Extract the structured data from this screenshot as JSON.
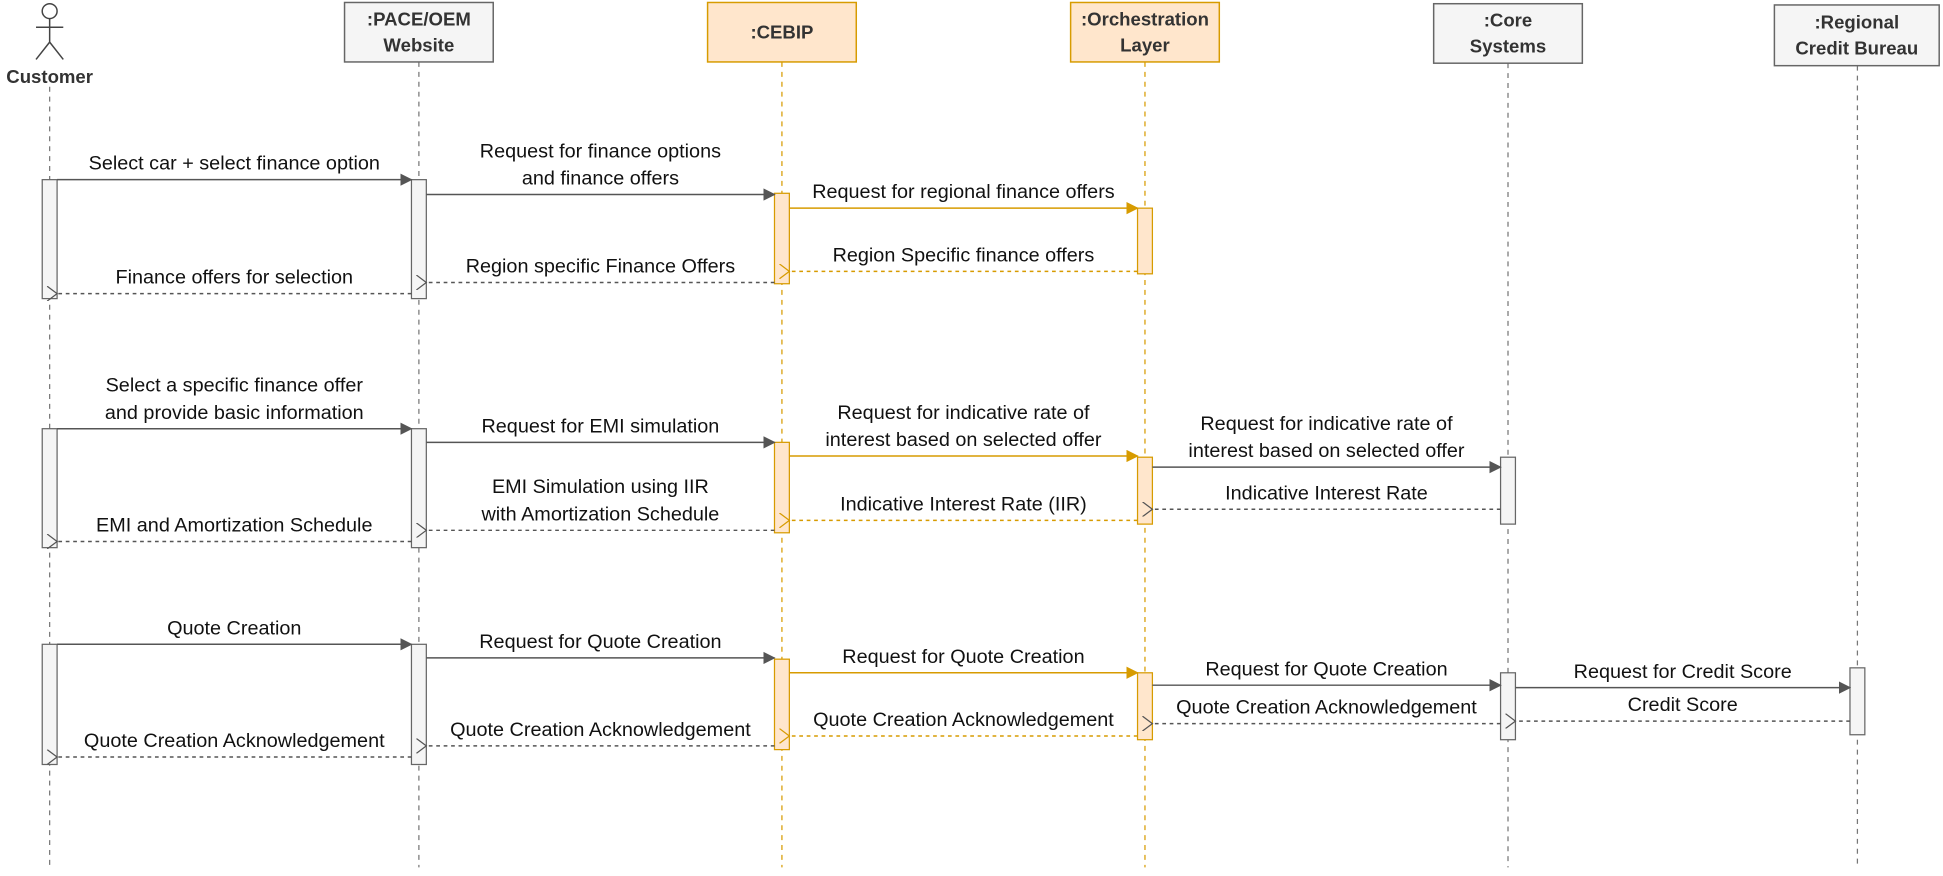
{
  "colors": {
    "accent_fill": "#ffe6cc",
    "accent_stroke": "#d79b00",
    "neutral_fill": "#f5f5f5",
    "neutral_stroke": "#666666",
    "arrow": "#555555"
  },
  "participants": [
    {
      "id": "customer",
      "kind": "actor",
      "lines": [
        "Customer"
      ],
      "highlight": false
    },
    {
      "id": "website",
      "kind": "box",
      "lines": [
        ":PACE/OEM",
        "Website"
      ],
      "highlight": false
    },
    {
      "id": "cebip",
      "kind": "box",
      "lines": [
        ":CEBIP"
      ],
      "highlight": true
    },
    {
      "id": "orchestration",
      "kind": "box",
      "lines": [
        ":Orchestration",
        "Layer"
      ],
      "highlight": true
    },
    {
      "id": "core",
      "kind": "box",
      "lines": [
        ":Core",
        "Systems"
      ],
      "highlight": false
    },
    {
      "id": "bureau",
      "kind": "box",
      "lines": [
        ":Regional",
        "Credit Bureau"
      ],
      "highlight": false
    }
  ],
  "messages": [
    {
      "from": 0,
      "to": 1,
      "lines": [
        "Select car + select finance option"
      ],
      "dashed": false
    },
    {
      "from": 1,
      "to": 2,
      "lines": [
        "Request for finance options",
        "and finance offers"
      ],
      "dashed": false
    },
    {
      "from": 2,
      "to": 3,
      "lines": [
        "Request for regional finance offers"
      ],
      "dashed": false
    },
    {
      "from": 3,
      "to": 2,
      "lines": [
        "Region Specific finance offers"
      ],
      "dashed": true
    },
    {
      "from": 2,
      "to": 1,
      "lines": [
        "Region specific Finance Offers"
      ],
      "dashed": true
    },
    {
      "from": 1,
      "to": 0,
      "lines": [
        "Finance offers for selection"
      ],
      "dashed": true
    },
    {
      "from": 0,
      "to": 1,
      "lines": [
        "Select a specific finance offer",
        "and provide basic information"
      ],
      "dashed": false
    },
    {
      "from": 1,
      "to": 2,
      "lines": [
        "Request for EMI simulation"
      ],
      "dashed": false
    },
    {
      "from": 2,
      "to": 3,
      "lines": [
        "Request for indicative rate of",
        "interest based on selected offer"
      ],
      "dashed": false
    },
    {
      "from": 3,
      "to": 4,
      "lines": [
        "Request for indicative rate of",
        "interest based on selected offer"
      ],
      "dashed": false
    },
    {
      "from": 4,
      "to": 3,
      "lines": [
        "Indicative Interest Rate"
      ],
      "dashed": true
    },
    {
      "from": 3,
      "to": 2,
      "lines": [
        "Indicative Interest Rate (IIR)"
      ],
      "dashed": true
    },
    {
      "from": 2,
      "to": 1,
      "lines": [
        "EMI Simulation using IIR",
        "with Amortization Schedule"
      ],
      "dashed": true
    },
    {
      "from": 1,
      "to": 0,
      "lines": [
        "EMI and Amortization Schedule"
      ],
      "dashed": true
    },
    {
      "from": 0,
      "to": 1,
      "lines": [
        "Quote Creation"
      ],
      "dashed": false
    },
    {
      "from": 1,
      "to": 2,
      "lines": [
        "Request for Quote Creation"
      ],
      "dashed": false
    },
    {
      "from": 2,
      "to": 3,
      "lines": [
        "Request for Quote Creation"
      ],
      "dashed": false
    },
    {
      "from": 3,
      "to": 4,
      "lines": [
        "Request for Quote Creation"
      ],
      "dashed": false
    },
    {
      "from": 4,
      "to": 5,
      "lines": [
        "Request for Credit Score"
      ],
      "dashed": false
    },
    {
      "from": 5,
      "to": 4,
      "lines": [
        "Credit Score"
      ],
      "dashed": true
    },
    {
      "from": 4,
      "to": 3,
      "lines": [
        "Quote Creation Acknowledgement"
      ],
      "dashed": true
    },
    {
      "from": 3,
      "to": 2,
      "lines": [
        "Quote Creation Acknowledgement"
      ],
      "dashed": true
    },
    {
      "from": 2,
      "to": 1,
      "lines": [
        "Quote Creation Acknowledgement"
      ],
      "dashed": true
    },
    {
      "from": 1,
      "to": 0,
      "lines": [
        "Quote Creation Acknowledgement"
      ],
      "dashed": true
    }
  ]
}
